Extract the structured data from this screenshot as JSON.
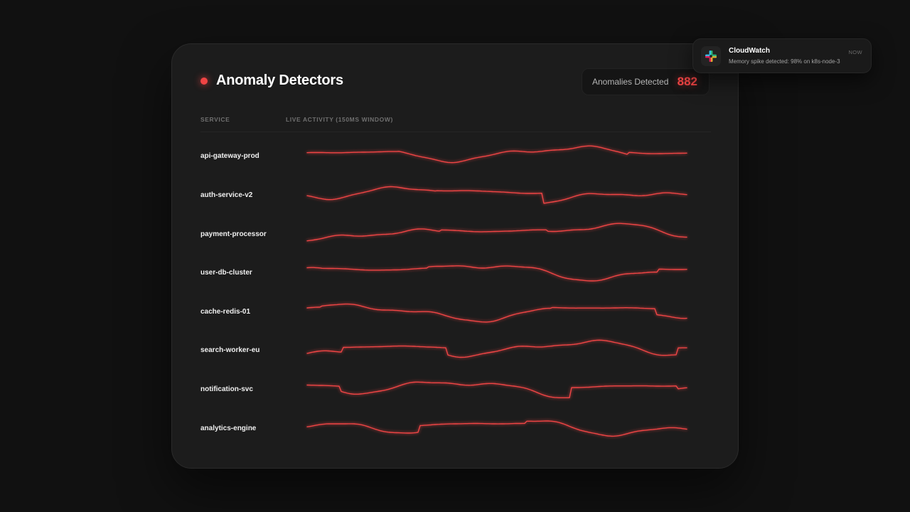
{
  "panel": {
    "title": "Anomaly Detectors",
    "anomalies_label": "Anomalies Detected",
    "anomalies_count": "882",
    "columns": {
      "service": "SERVICE",
      "activity": "LIVE ACTIVITY (150MS WINDOW)"
    }
  },
  "services": [
    {
      "name": "api-gateway-prod"
    },
    {
      "name": "auth-service-v2"
    },
    {
      "name": "payment-processor"
    },
    {
      "name": "user-db-cluster"
    },
    {
      "name": "cache-redis-01"
    },
    {
      "name": "search-worker-eu"
    },
    {
      "name": "notification-svc"
    },
    {
      "name": "analytics-engine"
    }
  ],
  "notification": {
    "app": "CloudWatch",
    "time": "NOW",
    "message": "Memory spike detected: 98% on k8s-node-3",
    "icon": "slack-icon"
  },
  "colors": {
    "accent": "#ef4444",
    "background": "#111111",
    "panel": "#1c1c1c"
  }
}
